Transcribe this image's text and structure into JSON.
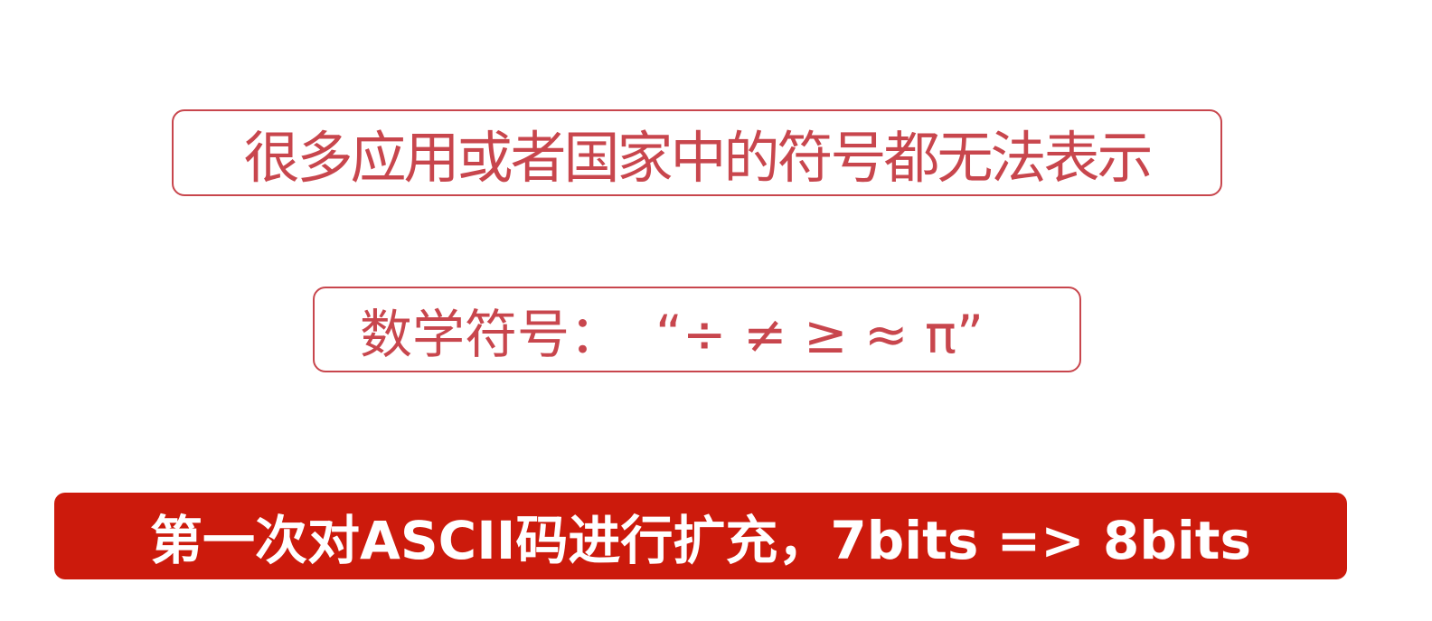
{
  "slide": {
    "statement": "很多应用或者国家中的符号都无法表示",
    "math_symbols_text": "数学符号：  “÷ ≠ ≥ ≈ π”",
    "banner_text": "第一次对ASCII码进行扩充，7bits => 8bits"
  },
  "colors": {
    "outline_text": "#c8464d",
    "banner_background": "#cc1a0c",
    "banner_text": "#ffffff",
    "background": "#ffffff"
  }
}
